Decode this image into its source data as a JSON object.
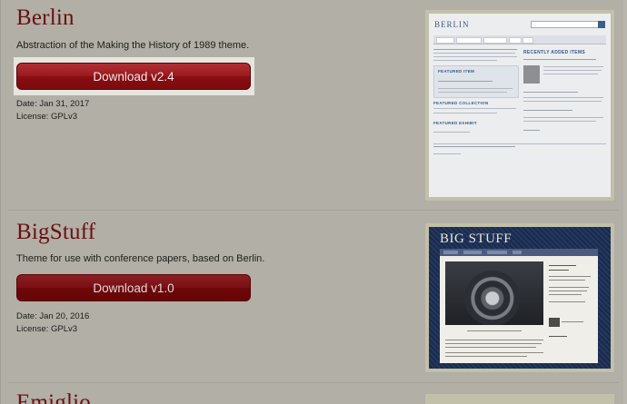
{
  "themes": [
    {
      "id": "berlin",
      "title": "Berlin",
      "description": "Abstraction of the Making the History of 1989 theme.",
      "download_label": "Download v2.4",
      "date": "Date: Jan 31, 2017",
      "license": "License: GPLv3",
      "thumbnail": {
        "brand": "BERLIN",
        "featured_item": "FEATURED ITEM",
        "featured_collection": "FEATURED COLLECTION",
        "featured_exhibit": "FEATURED EXHIBIT",
        "recently_added": "RECENTLY ADDED ITEMS"
      }
    },
    {
      "id": "bigstuff",
      "title": "BigStuff",
      "description": "Theme for use with conference papers, based on Berlin.",
      "download_label": "Download v1.0",
      "date": "Date: Jan 20, 2016",
      "license": "License: GPLv3",
      "thumbnail": {
        "brand": "BIG STUFF"
      }
    },
    {
      "id": "emiglio",
      "title": "Emiglio"
    }
  ],
  "colors": {
    "page_bg": "#b1afa6",
    "title": "#6a0f12",
    "button": "#8a0d11",
    "thumb_frame": "#c2c0a8"
  }
}
